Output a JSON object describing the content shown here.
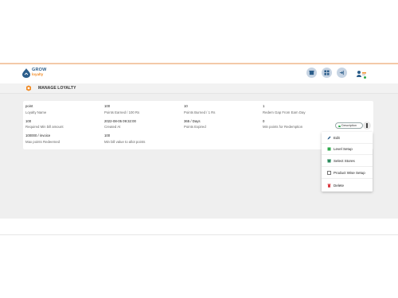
{
  "brand": {
    "name": "GROW",
    "tagline": "loyalty"
  },
  "header": {
    "icons": [
      "store-icon",
      "dashboard-icon",
      "logout-icon",
      "user-icon"
    ],
    "accent": "#f3c9a8",
    "button_bg": "#c7d4e3",
    "online_color": "#2eaa4b"
  },
  "page": {
    "title": "MANAGE LOYALTY"
  },
  "loyalty": {
    "row1": [
      {
        "value": "point",
        "label": "Loyalty Name"
      },
      {
        "value": "100",
        "label": "Points Earned / 100 Rs"
      },
      {
        "value": "10",
        "label": "Points Burned / 1 Rs"
      },
      {
        "value": "1",
        "label": "Redem Gap From Earn Day"
      }
    ],
    "row2": [
      {
        "value": "100",
        "label": "Required Min bill amount"
      },
      {
        "value": "2022-08-05 09:32:00",
        "label": "Created At"
      },
      {
        "value": "365 / Days",
        "label": "Points Expired"
      },
      {
        "value": "0",
        "label": "Min points for Redemption"
      }
    ],
    "row3": [
      {
        "value": "100000 / invoice",
        "label": "Max points Redeemed"
      },
      {
        "value": "100",
        "label": "Min bill value to allot points"
      }
    ]
  },
  "actions": {
    "description_label": "Description",
    "menu": [
      {
        "label": "Edit",
        "icon": "pencil-icon"
      },
      {
        "label": "Level Setup",
        "icon": "level-icon"
      },
      {
        "label": "Select Stores",
        "icon": "store-icon"
      },
      {
        "label": "Product Wise Setup",
        "icon": "product-icon"
      },
      {
        "label": "Delete",
        "icon": "trash-icon"
      }
    ]
  }
}
